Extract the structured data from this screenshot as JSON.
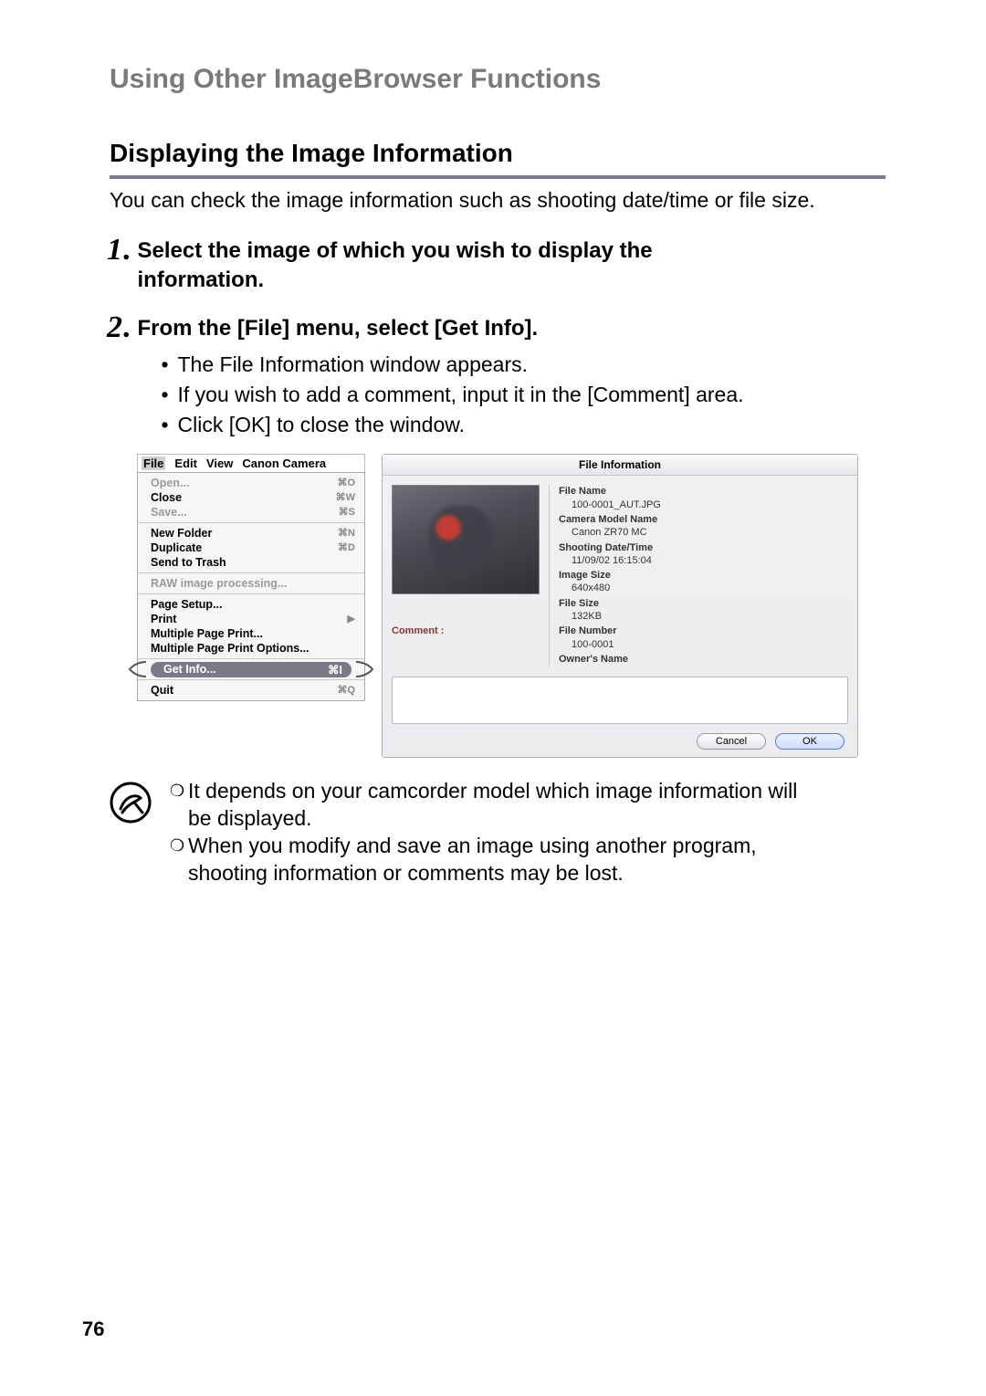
{
  "header": {
    "text": "Using Other ImageBrowser Functions"
  },
  "section": {
    "title": "Displaying the Image Information",
    "intro": "You can check the image information such as shooting date/time or file size."
  },
  "steps": [
    {
      "n": "1",
      "title_line1": "Select the image of which you wish to display the",
      "title_line2": "information."
    },
    {
      "n": "2",
      "title_line1": "From the [File] menu, select [Get Info].",
      "bullets": [
        "The File Information window appears.",
        "If you wish to add a comment, input it in the [Comment] area.",
        "Click [OK] to close the window."
      ]
    }
  ],
  "filemenu": {
    "menubar": [
      "File",
      "Edit",
      "View",
      "Canon Camera"
    ],
    "groups": [
      [
        {
          "label": "Open...",
          "shortcut": "⌘O",
          "disabled": true
        },
        {
          "label": "Close",
          "shortcut": "⌘W",
          "disabled": false
        },
        {
          "label": "Save...",
          "shortcut": "⌘S",
          "disabled": true
        }
      ],
      [
        {
          "label": "New Folder",
          "shortcut": "⌘N",
          "disabled": false
        },
        {
          "label": "Duplicate",
          "shortcut": "⌘D",
          "disabled": false
        },
        {
          "label": "Send to Trash",
          "shortcut": "",
          "disabled": false
        }
      ],
      [
        {
          "label": "RAW image processing...",
          "shortcut": "",
          "disabled": true
        }
      ],
      [
        {
          "label": "Page Setup...",
          "shortcut": "",
          "disabled": false
        },
        {
          "label": "Print",
          "shortcut": "▶",
          "disabled": false
        },
        {
          "label": "Multiple Page Print...",
          "shortcut": "",
          "disabled": false
        },
        {
          "label": "Multiple Page Print Options...",
          "shortcut": "",
          "disabled": false
        }
      ]
    ],
    "highlight": {
      "label": "Get Info...",
      "shortcut": "⌘I"
    },
    "quit": {
      "label": "Quit",
      "shortcut": "⌘Q"
    }
  },
  "dialog": {
    "title": "File Information",
    "comment_label": "Comment :",
    "meta": [
      {
        "k": "File Name",
        "v": "100-0001_AUT.JPG"
      },
      {
        "k": "Camera Model Name",
        "v": "Canon ZR70 MC"
      },
      {
        "k": "Shooting Date/Time",
        "v": "11/09/02 16:15:04"
      },
      {
        "k": "Image Size",
        "v": "640x480"
      },
      {
        "k": "File Size",
        "v": "132KB"
      },
      {
        "k": "File Number",
        "v": "100-0001"
      },
      {
        "k": "Owner's Name",
        "v": ""
      }
    ],
    "buttons": {
      "cancel": "Cancel",
      "ok": "OK"
    }
  },
  "notes": [
    {
      "l1": "It depends on your camcorder model which image information will",
      "l2": "be displayed."
    },
    {
      "l1": "When you modify and save an image using another program,",
      "l2": "shooting information or comments may be lost."
    }
  ],
  "page_number": "76"
}
